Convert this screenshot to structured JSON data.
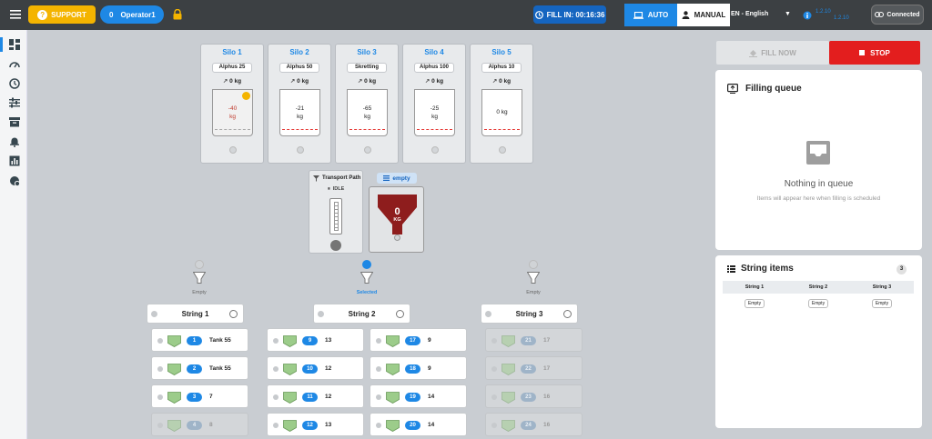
{
  "header": {
    "support_label": "SUPPORT",
    "operator_count": "0",
    "operator_name": "Operator1",
    "fill_in_label": "FILL IN: 00:16:36",
    "mode_auto": "AUTO",
    "mode_manual": "MANUAL",
    "language": "EN - English",
    "version_a": "1.2.10",
    "version_b": "1.2.10",
    "connected_label": "Connected"
  },
  "sidebar": {
    "icons": [
      "dashboard-icon",
      "speedometer-icon",
      "clock-icon",
      "sliders-icon",
      "archive-icon",
      "alarm-icon",
      "bar-chart-icon",
      "pie-chart-icon"
    ]
  },
  "silos": [
    {
      "name": "Silo 1",
      "product": "Alphus 25",
      "weight": "0 kg",
      "value": "-40",
      "unit": "kg",
      "warning": true
    },
    {
      "name": "Silo 2",
      "product": "Alphus 50",
      "weight": "0 kg",
      "value": "-21",
      "unit": "kg",
      "warning": false
    },
    {
      "name": "Silo 3",
      "product": "Skretting",
      "weight": "0 kg",
      "value": "-65",
      "unit": "kg",
      "warning": false
    },
    {
      "name": "Silo 4",
      "product": "Alphus 100",
      "weight": "0 kg",
      "value": "-25",
      "unit": "kg",
      "warning": false
    },
    {
      "name": "Silo 5",
      "product": "Alphus 10",
      "weight": "0 kg",
      "value": "0 kg",
      "unit": "",
      "warning": false
    }
  ],
  "transport": {
    "title": "Transport Path",
    "status": "IDLE"
  },
  "scale": {
    "tag": "empty",
    "value": "0",
    "unit": "KG"
  },
  "funnels": [
    {
      "label": "Empty"
    },
    {
      "label": "Selected"
    },
    {
      "label": "Empty"
    }
  ],
  "strings": [
    {
      "name": "String 1",
      "items": [
        {
          "num": "1",
          "label": "Tank 55",
          "enabled": true
        },
        {
          "num": "2",
          "label": "Tank 55",
          "enabled": true
        },
        {
          "num": "3",
          "label": "7",
          "enabled": true
        },
        {
          "num": "4",
          "label": "8",
          "enabled": false
        }
      ]
    },
    {
      "name": "String 2",
      "items": [
        {
          "num": "9",
          "label": "13",
          "enabled": true
        },
        {
          "num": "17",
          "label": "9",
          "enabled": true
        },
        {
          "num": "10",
          "label": "12",
          "enabled": true
        },
        {
          "num": "18",
          "label": "9",
          "enabled": true
        },
        {
          "num": "11",
          "label": "12",
          "enabled": true
        },
        {
          "num": "19",
          "label": "14",
          "enabled": true
        },
        {
          "num": "12",
          "label": "13",
          "enabled": true
        },
        {
          "num": "20",
          "label": "14",
          "enabled": true
        }
      ]
    },
    {
      "name": "String 3",
      "items": [
        {
          "num": "21",
          "label": "17",
          "enabled": false
        },
        {
          "num": "22",
          "label": "17",
          "enabled": false
        },
        {
          "num": "23",
          "label": "16",
          "enabled": false
        },
        {
          "num": "24",
          "label": "16",
          "enabled": false
        }
      ]
    }
  ],
  "controls": {
    "fill_now": "FILL NOW",
    "stop": "STOP"
  },
  "queue": {
    "title": "Filling queue",
    "empty_title": "Nothing in queue",
    "empty_sub": "Items will appear here when filling is scheduled"
  },
  "string_items": {
    "title": "String items",
    "count": "3",
    "columns": [
      "String 1",
      "String 2",
      "String 3"
    ],
    "values": [
      "Empty",
      "Empty",
      "Empty"
    ]
  },
  "colors": {
    "accent": "#1e88e5",
    "stop": "#e31e1e",
    "support": "#f4b400",
    "tank_green": "#9ccc8a"
  }
}
